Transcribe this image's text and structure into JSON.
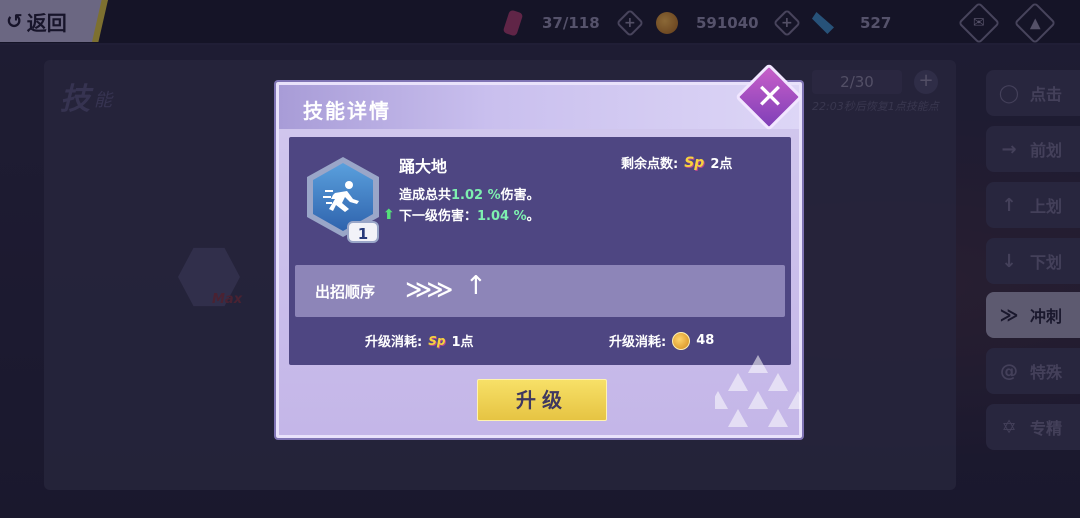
{
  "topbar": {
    "back_label": "返回",
    "stamina": "37/118",
    "coins": "591040",
    "crystals": "527",
    "icons": [
      "mail-icon",
      "notice-icon"
    ]
  },
  "skill_panel": {
    "title": "技",
    "subtitle": "能",
    "points": "2/30",
    "points_plus": "+",
    "recover_text": "22:03秒后恢复1点技能点",
    "node_level": "Max"
  },
  "side_menu": [
    {
      "label": "点击",
      "icon": "circle-icon"
    },
    {
      "label": "前划",
      "icon": "arrow-right-icon"
    },
    {
      "label": "上划",
      "icon": "arrow-up-icon"
    },
    {
      "label": "下划",
      "icon": "arrow-down-icon"
    },
    {
      "label": "冲刺",
      "icon": "dash-icon",
      "active": true
    },
    {
      "label": "特殊",
      "icon": "swirl-icon"
    },
    {
      "label": "专精",
      "icon": "star-icon"
    }
  ],
  "modal": {
    "title": "技能详情",
    "close_label": "✕",
    "skill": {
      "name": "踊大地",
      "level": "1",
      "effect_prefix": "造成总共",
      "effect_value": "1.02 %",
      "effect_suffix": "伤害。",
      "next_prefix": "下一级伤害：",
      "next_value": "1.04 %",
      "next_suffix": "。"
    },
    "remaining_label": "剩余点数:",
    "remaining_value": "2点",
    "sp_text": "Sp",
    "order_label": "出招顺序",
    "order_sequence": [
      "dash-icon",
      "arrow-up-icon"
    ],
    "cost_sp_label": "升级消耗:",
    "cost_sp_value": "1点",
    "cost_coin_label": "升级消耗:",
    "cost_coin_value": "48",
    "upgrade_label": "升级"
  }
}
